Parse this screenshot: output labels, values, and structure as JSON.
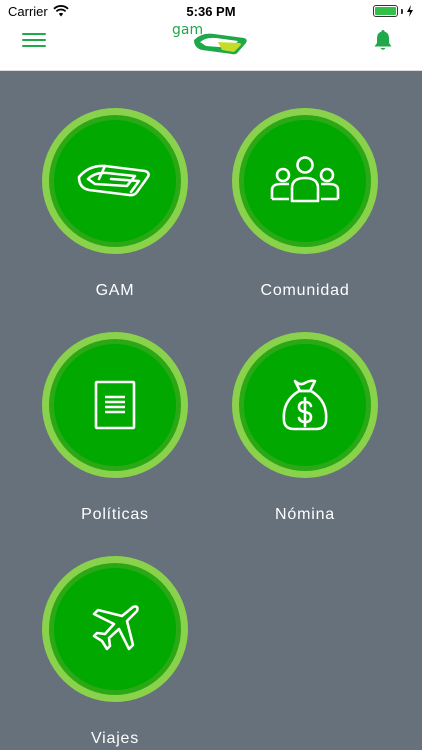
{
  "status": {
    "carrier": "Carrier",
    "time": "5:36 PM",
    "battery_level": 1.0
  },
  "header": {
    "logo_text": "gam",
    "menu_icon": "hamburger-icon",
    "bell_icon": "bell-icon",
    "accent": "#20a84a"
  },
  "tiles": [
    {
      "label": "GAM",
      "icon": "gam-logo-icon"
    },
    {
      "label": "Comunidad",
      "icon": "community-icon"
    },
    {
      "label": "Políticas",
      "icon": "document-icon"
    },
    {
      "label": "Nómina",
      "icon": "money-bag-icon"
    },
    {
      "label": "Viajes",
      "icon": "airplane-icon"
    }
  ],
  "colors": {
    "background": "#66717b",
    "circle_outer": "#8ad24c",
    "circle_inner": "#00a800"
  }
}
